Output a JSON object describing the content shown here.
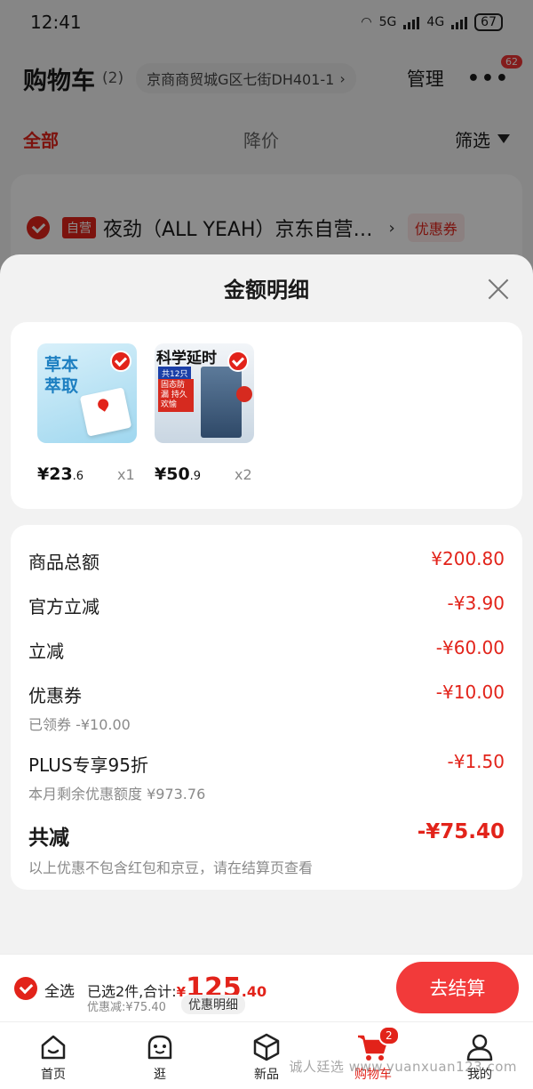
{
  "status_bar": {
    "time": "12:41",
    "battery": "67",
    "net1": "5G",
    "net2": "4G"
  },
  "cart_header": {
    "title": "购物车",
    "count": "(2)",
    "address": "京商商贸城G区七街DH401-1",
    "manage": "管理",
    "message_badge": "62"
  },
  "filter": {
    "all": "全部",
    "price_drop": "降价",
    "filter": "筛选"
  },
  "shop": {
    "self_tag": "自营",
    "name": "夜劲（ALL YEAH）京东自营…",
    "coupon": "优惠券"
  },
  "sheet": {
    "title": "金额明细",
    "products": [
      {
        "img_text": "草本萃取",
        "price_int": "¥23",
        "price_dec": ".6",
        "qty": "x1"
      },
      {
        "img_text": "科学延时",
        "tag1": "共12只",
        "tag2": "固态防漏 持久欢愉",
        "price_int": "¥50",
        "price_dec": ".9",
        "qty": "x2"
      }
    ],
    "details": {
      "goods_total": {
        "label": "商品总额",
        "value": "¥200.80"
      },
      "official_cut": {
        "label": "官方立减",
        "value": "-¥3.90"
      },
      "instant_cut": {
        "label": "立减",
        "value": "-¥60.00"
      },
      "coupon": {
        "label": "优惠券",
        "value": "-¥10.00",
        "sub": "已领券 -¥10.00"
      },
      "plus": {
        "label": "PLUS专享95折",
        "value": "-¥1.50",
        "sub": "本月剩余优惠额度 ¥973.76"
      },
      "total_cut": {
        "label": "共减",
        "value": "-¥75.40",
        "sub": "以上优惠不包含红包和京豆，请在结算页查看"
      }
    }
  },
  "checkout": {
    "select_all": "全选",
    "selected_text": "已选2件,合计:",
    "currency": "¥",
    "amount_int": "125",
    "amount_dec": ".40",
    "discount": "优惠减:¥75.40",
    "detail_btn": "优惠明细",
    "checkout_btn": "去结算"
  },
  "tabbar": {
    "items": [
      {
        "label": "首页"
      },
      {
        "label": "逛"
      },
      {
        "label": "新品"
      },
      {
        "label": "购物车",
        "badge": "2"
      },
      {
        "label": "我的"
      }
    ]
  },
  "watermark": "诚人廷选 www.yuanxuan123.com",
  "colors": {
    "accent": "#e2231a",
    "checkout_button": "#f23a3a",
    "overlay": "rgba(0,0,0,0.45)"
  }
}
